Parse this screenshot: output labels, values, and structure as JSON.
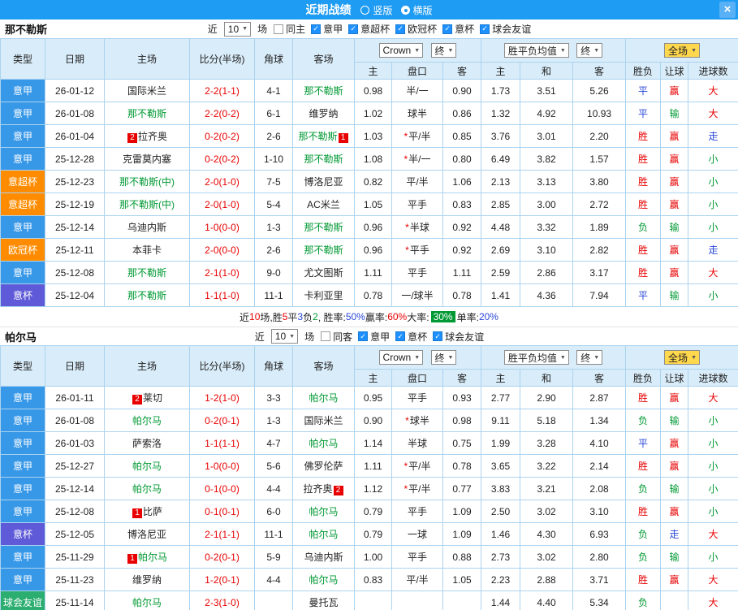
{
  "topbar": {
    "title": "近期战绩",
    "radios": [
      {
        "label": "竖版",
        "checked": false
      },
      {
        "label": "横版",
        "checked": true
      }
    ],
    "bar_color": "#1e9bf2"
  },
  "icons": {
    "close": "×",
    "dropdown_arrow": "▼",
    "check": "✓"
  },
  "columns": {
    "type": "类型",
    "date": "日期",
    "home": "主场",
    "score": "比分(半场)",
    "corner": "角球",
    "away": "客场",
    "asia_home": "主",
    "asia_handicap": "盘口",
    "asia_away": "客",
    "eu_home": "主",
    "eu_draw": "和",
    "eu_away": "客",
    "result": "胜负",
    "handicap_result": "让球",
    "goals": "进球数"
  },
  "league_colors": {
    "意甲": "#3898e8",
    "意超杯": "#ff8c00",
    "欧冠杯": "#ff8c00",
    "意杯": "#5e5ad8",
    "球会友谊": "#2bae70"
  },
  "result_colors": {
    "red": "#e80000",
    "green": "#009933",
    "blue": "#2947d8"
  },
  "team_color": "#009933",
  "sections": [
    {
      "team": "那不勒斯",
      "near_label": "近",
      "near_count": "10",
      "games_label": "场",
      "filters": [
        {
          "label": "同主",
          "checked": false
        },
        {
          "label": "意甲",
          "checked": true
        },
        {
          "label": "意超杯",
          "checked": true
        },
        {
          "label": "欧冠杯",
          "checked": true
        },
        {
          "label": "意杯",
          "checked": true
        },
        {
          "label": "球会友谊",
          "checked": true
        }
      ],
      "dropdowns": {
        "book": "Crown",
        "final1": "终",
        "avg": "胜平负均值",
        "final2": "终",
        "scope": "全场"
      },
      "rows": [
        {
          "league": "意甲",
          "date": "26-01-12",
          "home": {
            "name": "国际米兰"
          },
          "score": "2-2(1-1)",
          "corner": "4-1",
          "away": {
            "name": "那不勒斯",
            "self": true
          },
          "ah": [
            "0.98",
            "半/一",
            "0.90"
          ],
          "star": false,
          "eu": [
            "1.73",
            "3.51",
            "5.26"
          ],
          "res": [
            "平",
            "blue"
          ],
          "let": [
            "赢",
            "red"
          ],
          "big": [
            "大",
            "red"
          ]
        },
        {
          "league": "意甲",
          "date": "26-01-08",
          "home": {
            "name": "那不勒斯",
            "self": true
          },
          "score": "2-2(0-2)",
          "corner": "6-1",
          "away": {
            "name": "维罗纳"
          },
          "ah": [
            "1.02",
            "球半",
            "0.86"
          ],
          "star": false,
          "eu": [
            "1.32",
            "4.92",
            "10.93"
          ],
          "res": [
            "平",
            "blue"
          ],
          "let": [
            "输",
            "green"
          ],
          "big": [
            "大",
            "red"
          ]
        },
        {
          "league": "意甲",
          "date": "26-01-04",
          "home": {
            "name": "拉齐奥",
            "badge": {
              "n": "2",
              "pos": "before"
            }
          },
          "score": "0-2(0-2)",
          "corner": "2-6",
          "away": {
            "name": "那不勒斯",
            "self": true,
            "badge": {
              "n": "1",
              "pos": "after"
            }
          },
          "ah": [
            "1.03",
            "平/半",
            "0.85"
          ],
          "star": true,
          "eu": [
            "3.76",
            "3.01",
            "2.20"
          ],
          "res": [
            "胜",
            "red"
          ],
          "let": [
            "赢",
            "red"
          ],
          "big": [
            "走",
            "blue"
          ]
        },
        {
          "league": "意甲",
          "date": "25-12-28",
          "home": {
            "name": "克雷莫内塞"
          },
          "score": "0-2(0-2)",
          "corner": "1-10",
          "away": {
            "name": "那不勒斯",
            "self": true
          },
          "ah": [
            "1.08",
            "半/一",
            "0.80"
          ],
          "star": true,
          "eu": [
            "6.49",
            "3.82",
            "1.57"
          ],
          "res": [
            "胜",
            "red"
          ],
          "let": [
            "赢",
            "red"
          ],
          "big": [
            "小",
            "green"
          ]
        },
        {
          "league": "意超杯",
          "date": "25-12-23",
          "home": {
            "name": "那不勒斯(中)",
            "self": true
          },
          "score": "2-0(1-0)",
          "corner": "7-5",
          "away": {
            "name": "博洛尼亚"
          },
          "ah": [
            "0.82",
            "平/半",
            "1.06"
          ],
          "star": false,
          "eu": [
            "2.13",
            "3.13",
            "3.80"
          ],
          "res": [
            "胜",
            "red"
          ],
          "let": [
            "赢",
            "red"
          ],
          "big": [
            "小",
            "green"
          ]
        },
        {
          "league": "意超杯",
          "date": "25-12-19",
          "home": {
            "name": "那不勒斯(中)",
            "self": true
          },
          "score": "2-0(1-0)",
          "corner": "5-4",
          "away": {
            "name": "AC米兰"
          },
          "ah": [
            "1.05",
            "平手",
            "0.83"
          ],
          "star": false,
          "eu": [
            "2.85",
            "3.00",
            "2.72"
          ],
          "res": [
            "胜",
            "red"
          ],
          "let": [
            "赢",
            "red"
          ],
          "big": [
            "小",
            "green"
          ]
        },
        {
          "league": "意甲",
          "date": "25-12-14",
          "home": {
            "name": "乌迪内斯"
          },
          "score": "1-0(0-0)",
          "corner": "1-3",
          "away": {
            "name": "那不勒斯",
            "self": true
          },
          "ah": [
            "0.96",
            "半球",
            "0.92"
          ],
          "star": true,
          "eu": [
            "4.48",
            "3.32",
            "1.89"
          ],
          "res": [
            "负",
            "green"
          ],
          "let": [
            "输",
            "green"
          ],
          "big": [
            "小",
            "green"
          ]
        },
        {
          "league": "欧冠杯",
          "date": "25-12-11",
          "home": {
            "name": "本菲卡"
          },
          "score": "2-0(0-0)",
          "corner": "2-6",
          "away": {
            "name": "那不勒斯",
            "self": true
          },
          "ah": [
            "0.96",
            "平手",
            "0.92"
          ],
          "star": true,
          "eu": [
            "2.69",
            "3.10",
            "2.82"
          ],
          "res": [
            "胜",
            "red"
          ],
          "let": [
            "赢",
            "red"
          ],
          "big": [
            "走",
            "blue"
          ]
        },
        {
          "league": "意甲",
          "date": "25-12-08",
          "home": {
            "name": "那不勒斯",
            "self": true
          },
          "score": "2-1(1-0)",
          "corner": "9-0",
          "away": {
            "name": "尤文图斯"
          },
          "ah": [
            "1.11",
            "平手",
            "1.11"
          ],
          "star": false,
          "eu": [
            "2.59",
            "2.86",
            "3.17"
          ],
          "res": [
            "胜",
            "red"
          ],
          "let": [
            "赢",
            "red"
          ],
          "big": [
            "大",
            "red"
          ]
        },
        {
          "league": "意杯",
          "date": "25-12-04",
          "home": {
            "name": "那不勒斯",
            "self": true
          },
          "score": "1-1(1-0)",
          "corner": "11-1",
          "away": {
            "name": "卡利亚里"
          },
          "ah": [
            "0.78",
            "一/球半",
            "0.78"
          ],
          "star": false,
          "eu": [
            "1.41",
            "4.36",
            "7.94"
          ],
          "res": [
            "平",
            "blue"
          ],
          "let": [
            "输",
            "green"
          ],
          "big": [
            "小",
            "green"
          ]
        }
      ],
      "summary": [
        {
          "t": "近"
        },
        {
          "t": "10",
          "c": "red"
        },
        {
          "t": "场,胜"
        },
        {
          "t": "5",
          "c": "red"
        },
        {
          "t": "平"
        },
        {
          "t": "3",
          "c": "blue"
        },
        {
          "t": "负"
        },
        {
          "t": "2",
          "c": "green"
        },
        {
          "t": ", 胜率:"
        },
        {
          "t": "50%",
          "c": "blue"
        },
        {
          "t": " 赢率:"
        },
        {
          "t": "60%",
          "c": "red"
        },
        {
          "t": " 大率:"
        },
        {
          "t": "30%",
          "badge": true
        },
        {
          "t": " 单率:"
        },
        {
          "t": "20%",
          "c": "blue"
        }
      ]
    },
    {
      "team": "帕尔马",
      "near_label": "近",
      "near_count": "10",
      "games_label": "场",
      "filters": [
        {
          "label": "同客",
          "checked": false
        },
        {
          "label": "意甲",
          "checked": true
        },
        {
          "label": "意杯",
          "checked": true
        },
        {
          "label": "球会友谊",
          "checked": true
        }
      ],
      "dropdowns": {
        "book": "Crown",
        "final1": "终",
        "avg": "胜平负均值",
        "final2": "终",
        "scope": "全场"
      },
      "rows": [
        {
          "league": "意甲",
          "date": "26-01-11",
          "home": {
            "name": "莱切",
            "badge": {
              "n": "2",
              "pos": "before"
            }
          },
          "score": "1-2(1-0)",
          "corner": "3-3",
          "away": {
            "name": "帕尔马",
            "self": true
          },
          "ah": [
            "0.95",
            "平手",
            "0.93"
          ],
          "star": false,
          "eu": [
            "2.77",
            "2.90",
            "2.87"
          ],
          "res": [
            "胜",
            "red"
          ],
          "let": [
            "赢",
            "red"
          ],
          "big": [
            "大",
            "red"
          ]
        },
        {
          "league": "意甲",
          "date": "26-01-08",
          "home": {
            "name": "帕尔马",
            "self": true
          },
          "score": "0-2(0-1)",
          "corner": "1-3",
          "away": {
            "name": "国际米兰"
          },
          "ah": [
            "0.90",
            "球半",
            "0.98"
          ],
          "star": true,
          "eu": [
            "9.11",
            "5.18",
            "1.34"
          ],
          "res": [
            "负",
            "green"
          ],
          "let": [
            "输",
            "green"
          ],
          "big": [
            "小",
            "green"
          ]
        },
        {
          "league": "意甲",
          "date": "26-01-03",
          "home": {
            "name": "萨索洛"
          },
          "score": "1-1(1-1)",
          "corner": "4-7",
          "away": {
            "name": "帕尔马",
            "self": true
          },
          "ah": [
            "1.14",
            "半球",
            "0.75"
          ],
          "star": false,
          "eu": [
            "1.99",
            "3.28",
            "4.10"
          ],
          "res": [
            "平",
            "blue"
          ],
          "let": [
            "赢",
            "red"
          ],
          "big": [
            "小",
            "green"
          ]
        },
        {
          "league": "意甲",
          "date": "25-12-27",
          "home": {
            "name": "帕尔马",
            "self": true
          },
          "score": "1-0(0-0)",
          "corner": "5-6",
          "away": {
            "name": "佛罗伦萨"
          },
          "ah": [
            "1.11",
            "平/半",
            "0.78"
          ],
          "star": true,
          "eu": [
            "3.65",
            "3.22",
            "2.14"
          ],
          "res": [
            "胜",
            "red"
          ],
          "let": [
            "赢",
            "red"
          ],
          "big": [
            "小",
            "green"
          ]
        },
        {
          "league": "意甲",
          "date": "25-12-14",
          "home": {
            "name": "帕尔马",
            "self": true
          },
          "score": "0-1(0-0)",
          "corner": "4-4",
          "away": {
            "name": "拉齐奥",
            "badge": {
              "n": "2",
              "pos": "after"
            }
          },
          "ah": [
            "1.12",
            "平/半",
            "0.77"
          ],
          "star": true,
          "eu": [
            "3.83",
            "3.21",
            "2.08"
          ],
          "res": [
            "负",
            "green"
          ],
          "let": [
            "输",
            "green"
          ],
          "big": [
            "小",
            "green"
          ]
        },
        {
          "league": "意甲",
          "date": "25-12-08",
          "home": {
            "name": "比萨",
            "badge": {
              "n": "1",
              "pos": "before"
            }
          },
          "score": "0-1(0-1)",
          "corner": "6-0",
          "away": {
            "name": "帕尔马",
            "self": true
          },
          "ah": [
            "0.79",
            "平手",
            "1.09"
          ],
          "star": false,
          "eu": [
            "2.50",
            "3.02",
            "3.10"
          ],
          "res": [
            "胜",
            "red"
          ],
          "let": [
            "赢",
            "red"
          ],
          "big": [
            "小",
            "green"
          ]
        },
        {
          "league": "意杯",
          "date": "25-12-05",
          "home": {
            "name": "博洛尼亚"
          },
          "score": "2-1(1-1)",
          "corner": "11-1",
          "away": {
            "name": "帕尔马",
            "self": true
          },
          "ah": [
            "0.79",
            "一球",
            "1.09"
          ],
          "star": false,
          "eu": [
            "1.46",
            "4.30",
            "6.93"
          ],
          "res": [
            "负",
            "green"
          ],
          "let": [
            "走",
            "blue"
          ],
          "big": [
            "大",
            "red"
          ]
        },
        {
          "league": "意甲",
          "date": "25-11-29",
          "home": {
            "name": "帕尔马",
            "self": true,
            "badge": {
              "n": "1",
              "pos": "before"
            }
          },
          "score": "0-2(0-1)",
          "corner": "5-9",
          "away": {
            "name": "乌迪内斯"
          },
          "ah": [
            "1.00",
            "平手",
            "0.88"
          ],
          "star": false,
          "eu": [
            "2.73",
            "3.02",
            "2.80"
          ],
          "res": [
            "负",
            "green"
          ],
          "let": [
            "输",
            "green"
          ],
          "big": [
            "小",
            "green"
          ]
        },
        {
          "league": "意甲",
          "date": "25-11-23",
          "home": {
            "name": "维罗纳"
          },
          "score": "1-2(0-1)",
          "corner": "4-4",
          "away": {
            "name": "帕尔马",
            "self": true
          },
          "ah": [
            "0.83",
            "平/半",
            "1.05"
          ],
          "star": false,
          "eu": [
            "2.23",
            "2.88",
            "3.71"
          ],
          "res": [
            "胜",
            "red"
          ],
          "let": [
            "赢",
            "red"
          ],
          "big": [
            "大",
            "red"
          ]
        },
        {
          "league": "球会友谊",
          "date": "25-11-14",
          "home": {
            "name": "帕尔马",
            "self": true
          },
          "score": "2-3(1-0)",
          "corner": "",
          "away": {
            "name": "曼托瓦"
          },
          "ah": [
            "",
            "",
            ""
          ],
          "star": false,
          "eu": [
            "1.44",
            "4.40",
            "5.34"
          ],
          "res": [
            "负",
            "green"
          ],
          "let": [
            "",
            ""
          ],
          "big": [
            "大",
            "red"
          ]
        }
      ],
      "summary": []
    }
  ]
}
